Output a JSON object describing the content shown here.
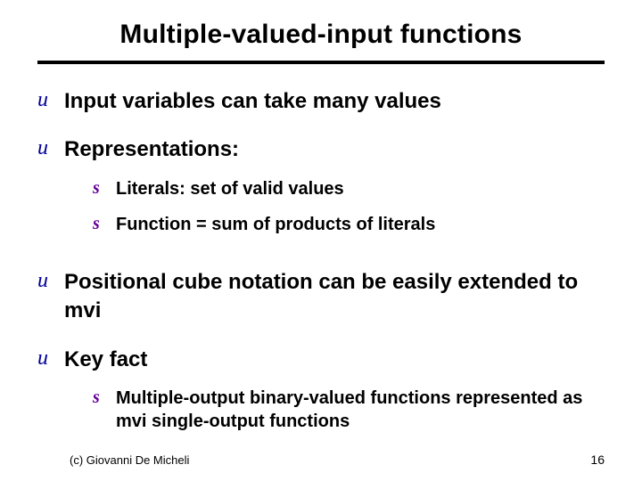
{
  "title": "Multiple-valued-input functions",
  "bullets": [
    {
      "mark": "u",
      "text": "Input variables can take many values"
    },
    {
      "mark": "u",
      "text": "Representations:",
      "sub": [
        {
          "mark": "s",
          "text": "Literals: set of valid values"
        },
        {
          "mark": "s",
          "text": "Function = sum of products of literals"
        }
      ]
    },
    {
      "mark": "u",
      "text": "Positional cube notation can be easily extended to mvi"
    },
    {
      "mark": "u",
      "text": "Key fact",
      "sub": [
        {
          "mark": "s",
          "text": "Multiple-output binary-valued functions represented as mvi single-output functions"
        }
      ]
    }
  ],
  "footer": {
    "copyright": "(c)  Giovanni De Micheli",
    "page": "16"
  }
}
